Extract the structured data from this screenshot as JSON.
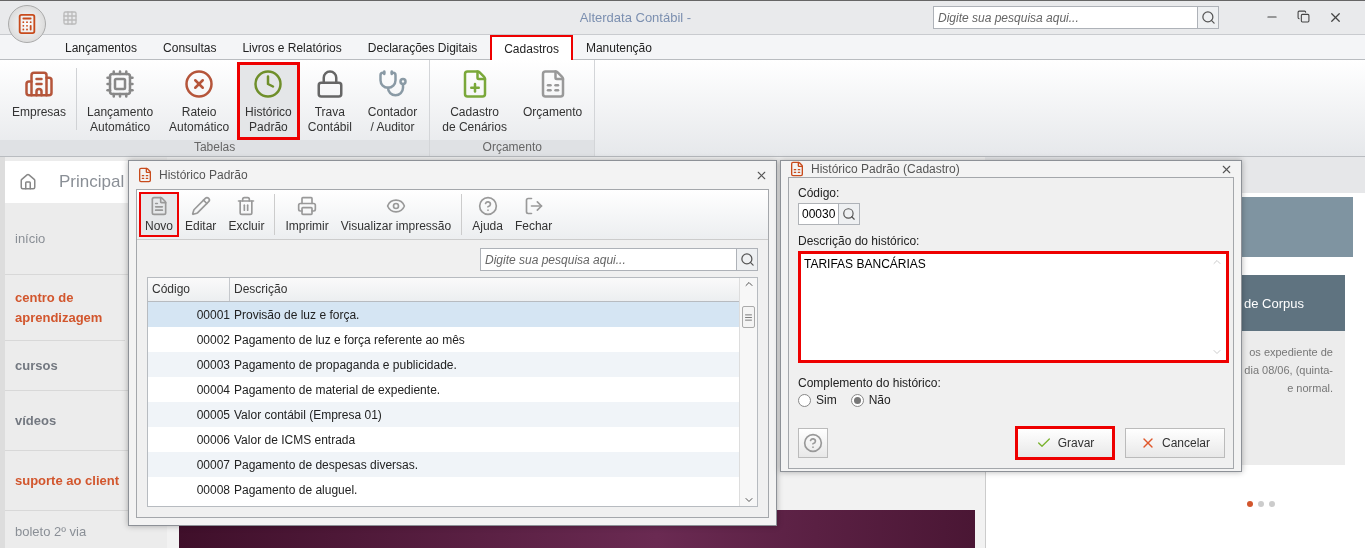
{
  "window": {
    "title": "Alterdata Contábil -",
    "search_placeholder": "Digite sua pesquisa aqui..."
  },
  "menu_tabs": [
    {
      "label": "Lançamentos",
      "selected": false,
      "highlighted": false
    },
    {
      "label": "Consultas",
      "selected": false,
      "highlighted": false
    },
    {
      "label": "Livros e Relatórios",
      "selected": false,
      "highlighted": false
    },
    {
      "label": "Declarações Digitais",
      "selected": false,
      "highlighted": false
    },
    {
      "label": "Cadastros",
      "selected": true,
      "highlighted": true
    },
    {
      "label": "Manutenção",
      "selected": false,
      "highlighted": false
    }
  ],
  "ribbon_groups": [
    {
      "title": "Tabelas",
      "buttons": [
        {
          "lines": [
            "Empresas"
          ],
          "highlighted": false
        },
        {
          "lines": [
            "Lançamento",
            "Automático"
          ],
          "highlighted": false
        },
        {
          "lines": [
            "Rateio",
            "Automático"
          ],
          "highlighted": false
        },
        {
          "lines": [
            "Histórico",
            "Padrão"
          ],
          "highlighted": true
        },
        {
          "lines": [
            "Trava",
            "Contábil"
          ],
          "highlighted": false
        },
        {
          "lines": [
            "Contador",
            "/ Auditor"
          ],
          "highlighted": false
        }
      ]
    },
    {
      "title": "Orçamento",
      "buttons": [
        {
          "lines": [
            "Cadastro",
            "de Cenários"
          ],
          "highlighted": false
        },
        {
          "lines": [
            "Orçamento"
          ],
          "highlighted": false
        }
      ]
    }
  ],
  "home_tab": {
    "label": "Principal"
  },
  "sidebar": {
    "items": [
      {
        "label": "início",
        "kind": "plain"
      },
      {
        "label": "centro de aprendizagem",
        "kind": "accent"
      },
      {
        "label": "cursos",
        "kind": "bold"
      },
      {
        "label": "vídeos",
        "kind": "bold"
      },
      {
        "label": "suporte ao client",
        "kind": "accent"
      },
      {
        "label": "boleto 2º via",
        "kind": "plain"
      }
    ]
  },
  "news_card": {
    "title": "de Corpus",
    "lines": [
      "os expediente de",
      "dia 08/06, (quinta-",
      "e normal."
    ]
  },
  "carousel_dots": [
    {
      "selected": true
    },
    {
      "selected": false
    },
    {
      "selected": false
    }
  ],
  "list_dialog": {
    "title": "Histórico Padrão",
    "toolbar": [
      [
        {
          "label": "Novo",
          "highlighted": true
        },
        {
          "label": "Editar",
          "highlighted": false
        },
        {
          "label": "Excluir",
          "highlighted": false
        }
      ],
      [
        {
          "label": "Imprimir",
          "highlighted": false
        },
        {
          "label": "Visualizar impressão",
          "highlighted": false
        }
      ],
      [
        {
          "label": "Ajuda",
          "highlighted": false
        },
        {
          "label": "Fechar",
          "highlighted": false
        }
      ]
    ],
    "search_placeholder": "Digite sua pesquisa aqui...",
    "columns": [
      "Código",
      "Descrição"
    ],
    "rows": [
      {
        "code": "00001",
        "description": "Provisão de luz e força.",
        "selected": true
      },
      {
        "code": "00002",
        "description": "Pagamento de luz e força referente ao mês",
        "selected": false
      },
      {
        "code": "00003",
        "description": "Pagamento de propaganda e publicidade.",
        "selected": false
      },
      {
        "code": "00004",
        "description": "Pagamento de material de expediente.",
        "selected": false
      },
      {
        "code": "00005",
        "description": "Valor contábil (Empresa 01)",
        "selected": false
      },
      {
        "code": "00006",
        "description": "Valor de ICMS entrada",
        "selected": false
      },
      {
        "code": "00007",
        "description": "Pagamento de despesas diversas.",
        "selected": false
      },
      {
        "code": "00008",
        "description": "Pagamento de aluguel.",
        "selected": false
      }
    ]
  },
  "form_dialog": {
    "title": "Histórico Padrão (Cadastro)",
    "code_label": "Código:",
    "code_value": "00030",
    "description_label": "Descrição do histórico:",
    "description_value": "TARIFAS BANCÁRIAS",
    "description_highlighted": true,
    "complement_label": "Complemento do histórico:",
    "complement_options": [
      {
        "label": "Sim",
        "selected": false
      },
      {
        "label": "Não",
        "selected": true
      }
    ],
    "save": {
      "label": "Gravar",
      "highlighted": true
    },
    "cancel": {
      "label": "Cancelar",
      "highlighted": false
    }
  }
}
